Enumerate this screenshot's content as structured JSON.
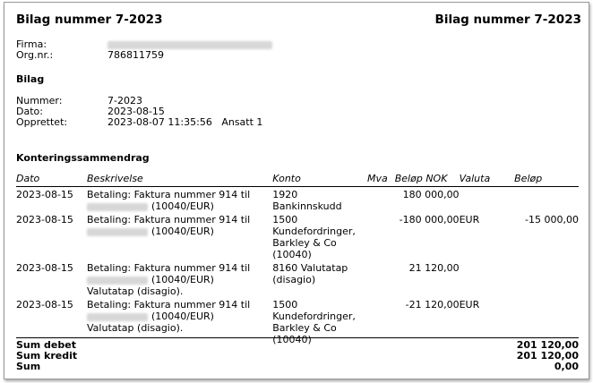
{
  "header": {
    "title_left": "Bilag nummer 7-2023",
    "title_right": "Bilag nummer 7-2023"
  },
  "company": {
    "firma_label": "Firma:",
    "firma_value": "",
    "org_label": "Org.nr.:",
    "org_value": "786811759"
  },
  "bilag": {
    "heading": "Bilag",
    "nummer_label": "Nummer:",
    "nummer_value": "7-2023",
    "dato_label": "Dato:",
    "dato_value": "2023-08-15",
    "opprettet_label": "Opprettet:",
    "opprettet_value": "2023-08-07 11:35:56",
    "opprettet_by": "Ansatt 1"
  },
  "summary": {
    "heading": "Konteringssammendrag",
    "columns": {
      "dato": "Dato",
      "beskrivelse": "Beskrivelse",
      "konto": "Konto",
      "mva": "Mva",
      "belop_nok": "Beløp NOK",
      "valuta": "Valuta",
      "belop": "Beløp"
    },
    "rows": [
      {
        "dato": "2023-08-15",
        "desc_line1": "Betaling: Faktura nummer 914 til",
        "desc_line2": "(10040/EUR)",
        "desc_line3": "",
        "konto_lines": [
          "1920 Bankinnskudd"
        ],
        "mva": "",
        "belop_nok": "180 000,00",
        "valuta": "",
        "belop": ""
      },
      {
        "dato": "2023-08-15",
        "desc_line1": "Betaling: Faktura nummer 914 til",
        "desc_line2": "(10040/EUR)",
        "desc_line3": "",
        "konto_lines": [
          "1500",
          "Kundefordringer,",
          "Barkley & Co",
          "(10040)"
        ],
        "mva": "",
        "belop_nok": "-180 000,00",
        "valuta": "EUR",
        "belop": "-15 000,00"
      },
      {
        "dato": "2023-08-15",
        "desc_line1": "Betaling: Faktura nummer 914 til",
        "desc_line2": "(10040/EUR)",
        "desc_line3": "Valutatap (disagio).",
        "konto_lines": [
          "8160 Valutatap",
          "(disagio)"
        ],
        "mva": "",
        "belop_nok": "21 120,00",
        "valuta": "",
        "belop": ""
      },
      {
        "dato": "2023-08-15",
        "desc_line1": "Betaling: Faktura nummer 914 til",
        "desc_line2": "(10040/EUR)",
        "desc_line3": "Valutatap (disagio).",
        "konto_lines": [
          "1500",
          "Kundefordringer,",
          "Barkley & Co",
          "(10040)"
        ],
        "mva": "",
        "belop_nok": "-21 120,00",
        "valuta": "EUR",
        "belop": ""
      }
    ]
  },
  "totals": {
    "sum_debet_label": "Sum debet",
    "sum_debet_value": "201 120,00",
    "sum_kredit_label": "Sum kredit",
    "sum_kredit_value": "201 120,00",
    "sum_label": "Sum",
    "sum_value": "0,00"
  }
}
